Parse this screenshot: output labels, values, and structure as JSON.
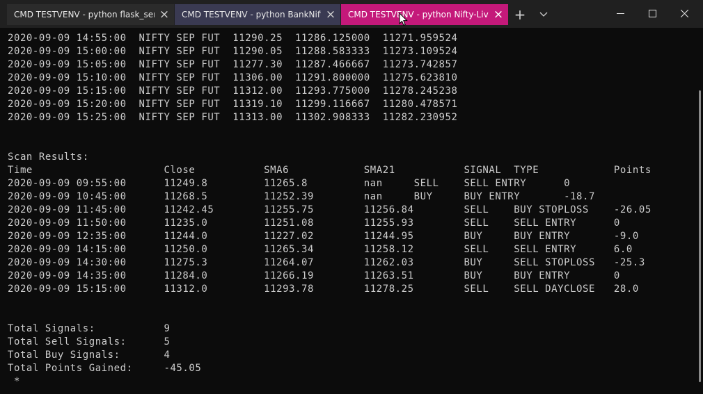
{
  "tabs": [
    {
      "title": "CMD TESTVENV - python  flask_serve"
    },
    {
      "title": "CMD TESTVENV - python  BankNifty-"
    },
    {
      "title": "CMD TESTVENV - python  Nifty-Live-"
    }
  ],
  "icons": {
    "close": "×",
    "new_tab": "+",
    "dropdown": "⌵",
    "minimize": "─",
    "maximize": "☐",
    "window_close": "✕"
  },
  "terminal_lines": [
    "2020-09-09 14:55:00  NIFTY SEP FUT  11290.25  11286.125000  11271.959524",
    "2020-09-09 15:00:00  NIFTY SEP FUT  11290.05  11288.583333  11273.109524",
    "2020-09-09 15:05:00  NIFTY SEP FUT  11277.30  11287.466667  11273.742857",
    "2020-09-09 15:10:00  NIFTY SEP FUT  11306.00  11291.800000  11275.623810",
    "2020-09-09 15:15:00  NIFTY SEP FUT  11312.00  11293.775000  11278.245238",
    "2020-09-09 15:20:00  NIFTY SEP FUT  11319.10  11299.116667  11280.478571",
    "2020-09-09 15:25:00  NIFTY SEP FUT  11313.00  11302.908333  11282.230952",
    "",
    "",
    "Scan Results:",
    "Time                     Close           SMA6            SMA21           SIGNAL  TYPE            Points",
    "2020-09-09 09:55:00      11249.8         11265.8         nan     SELL    SELL ENTRY      0",
    "2020-09-09 10:45:00      11268.5         11252.39        nan     BUY     BUY ENTRY       -18.7",
    "2020-09-09 11:45:00      11242.45        11255.75        11256.84        SELL    BUY STOPLOSS    -26.05",
    "2020-09-09 11:50:00      11235.0         11251.08        11255.93        SELL    SELL ENTRY      0",
    "2020-09-09 12:35:00      11244.0         11227.02        11244.95        BUY     BUY ENTRY       -9.0",
    "2020-09-09 14:15:00      11250.0         11265.34        11258.12        SELL    SELL ENTRY      6.0",
    "2020-09-09 14:30:00      11275.3         11264.07        11262.03        BUY     SELL STOPLOSS   -25.3",
    "2020-09-09 14:35:00      11284.0         11266.19        11263.51        BUY     BUY ENTRY       0",
    "2020-09-09 15:15:00      11312.0         11293.78        11278.25        SELL    SELL DAYCLOSE   28.0",
    "",
    "",
    "Total Signals:           9",
    "Total Sell Signals:      5",
    "Total Buy Signals:       4",
    "Total Points Gained:     -45.05",
    " *"
  ]
}
